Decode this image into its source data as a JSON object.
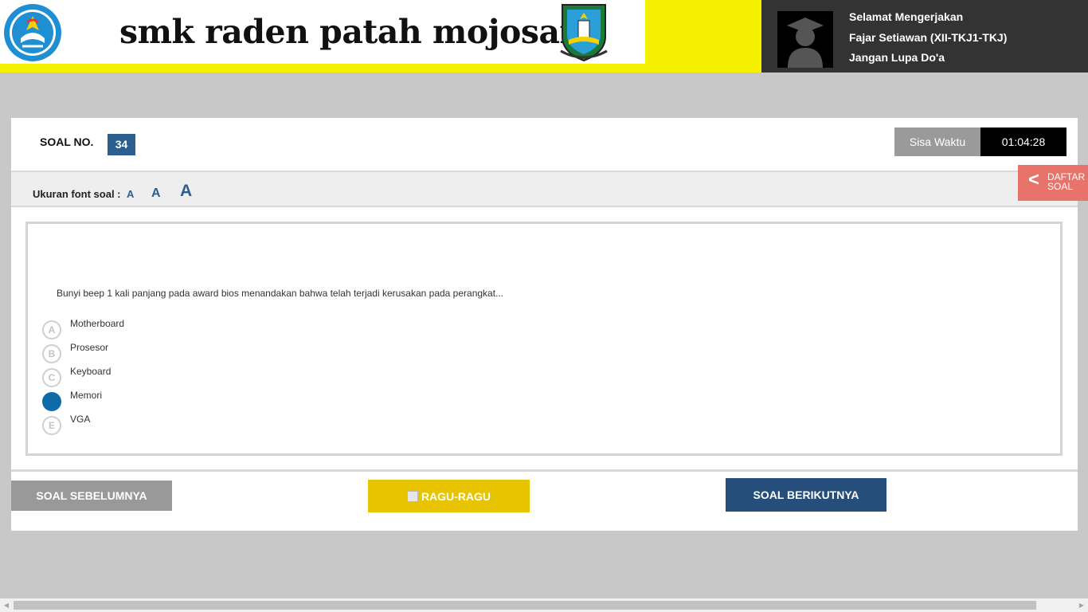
{
  "header": {
    "school_name": "smk raden patah mojosari",
    "greeting": "Selamat Mengerjakan",
    "user_name": "Fajar Setiawan (XII-TKJ1-TKJ)",
    "reminder": "Jangan Lupa Do'a",
    "colors": {
      "accent_yellow": "#f5ef00",
      "panel_dark": "#333333"
    }
  },
  "question_header": {
    "label": "SOAL NO.",
    "number": "34",
    "timer_label": "Sisa Waktu",
    "timer_value": "01:04:28"
  },
  "font_size": {
    "label": "Ukuran font soal :",
    "small": "A",
    "medium": "A",
    "large": "A"
  },
  "question": {
    "text": "Bunyi beep 1 kali panjang pada award bios menandakan bahwa telah terjadi kerusakan pada perangkat...",
    "options": [
      {
        "letter": "A",
        "text": "Motherboard",
        "selected": false
      },
      {
        "letter": "B",
        "text": "Prosesor",
        "selected": false
      },
      {
        "letter": "C",
        "text": "Keyboard",
        "selected": false
      },
      {
        "letter": "D",
        "text": "Memori",
        "selected": true
      },
      {
        "letter": "E",
        "text": "VGA",
        "selected": false
      }
    ]
  },
  "nav": {
    "prev_label": "SOAL SEBELUMNYA",
    "ragu_label": "RAGU-RAGU",
    "next_label": "SOAL BERIKUTNYA"
  },
  "daftar": {
    "arrow": "<",
    "line1": "DAFTAR",
    "line2": "SOAL"
  },
  "icons": {
    "logo_left": "tut-wuri-handayani-logo",
    "logo_right": "east-java-coat-of-arms",
    "avatar": "graduate-avatar-icon"
  }
}
